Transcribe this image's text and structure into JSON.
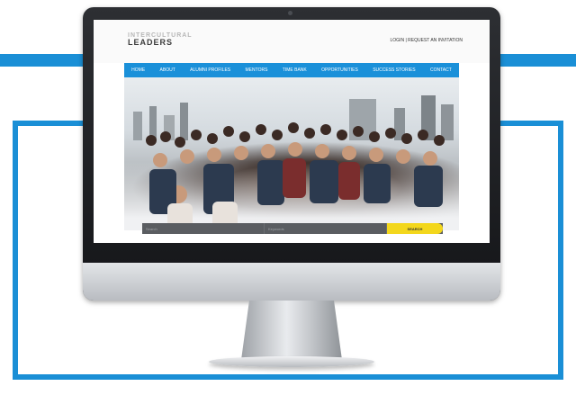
{
  "site": {
    "logo_line1": "INTERCULTURAL",
    "logo_line2": "LEADERS",
    "top_links": {
      "login": "LOGIN",
      "separator": "|",
      "request": "REQUEST AN INVITATION"
    }
  },
  "nav": {
    "items": [
      "HOME",
      "ABOUT",
      "ALUMNI PROFILES",
      "MENTORS",
      "TIME BANK",
      "OPPORTUNITIES",
      "SUCCESS STORIES",
      "CONTACT"
    ]
  },
  "search": {
    "keyword_placeholder": "Search",
    "location_placeholder": "Keywords",
    "button_label": "SEARCH"
  },
  "colors": {
    "brand_blue": "#1a90d9",
    "frame_blue": "#1a8fd6",
    "search_button": "#f3d71c",
    "search_bar": "#5a5d61"
  }
}
